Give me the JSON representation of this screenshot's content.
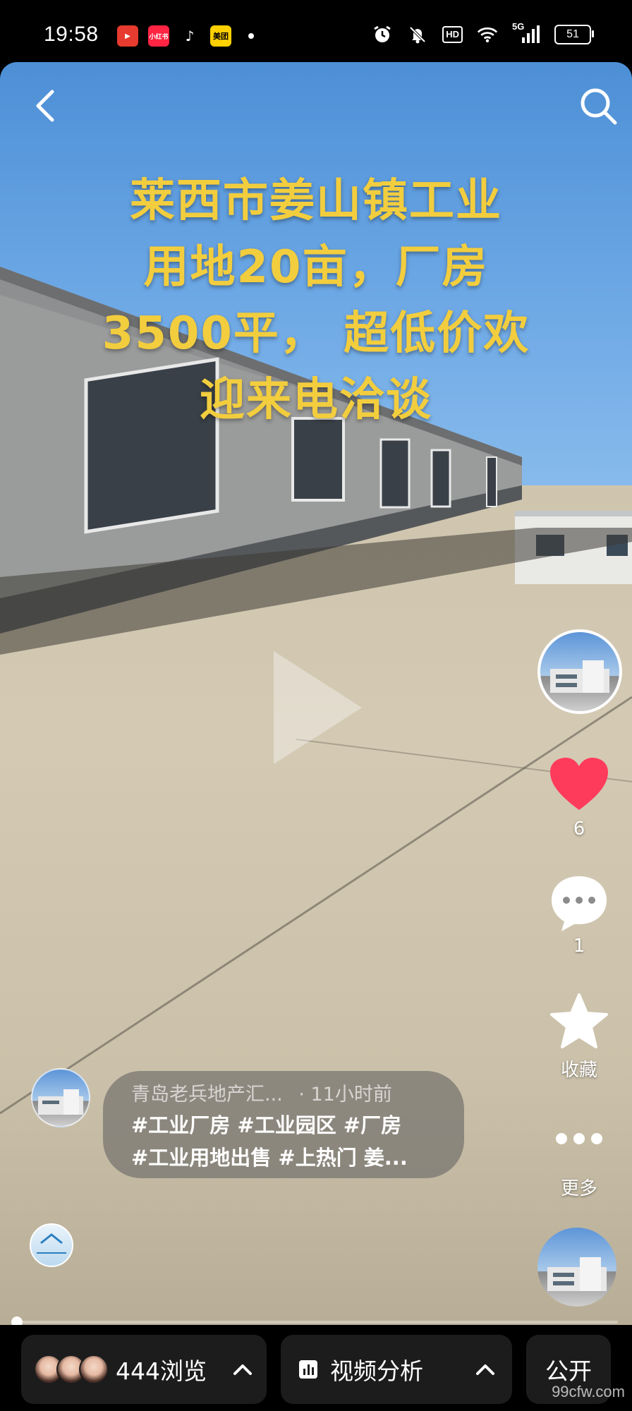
{
  "status_bar": {
    "time": "19:58",
    "app_icons": [
      "video-app-icon",
      "xiaohongshu-icon",
      "tiktok-icon",
      "meituan-icon"
    ],
    "app_icon_labels": [
      "▶",
      "小红书",
      "♪",
      "美团"
    ],
    "hd_label": "HD",
    "network_label": "5G",
    "battery": "51"
  },
  "video": {
    "title_lines": [
      "莱西市姜山镇工业",
      "用地20亩，厂房",
      "3500平， 超低价欢",
      "迎来电洽谈"
    ]
  },
  "rail": {
    "likes": "6",
    "comments": "1",
    "favorite_label": "收藏",
    "more_label": "更多"
  },
  "post": {
    "author": "青岛老兵地产汇...",
    "time_ago": "· 11小时前",
    "tags_line1": "#工业厂房 #工业园区 #厂房",
    "tags_line2": "#工业用地出售 #上热门 姜..."
  },
  "progress": {
    "fraction": 0.005
  },
  "bottom_bar": {
    "views_label": "444浏览",
    "analysis_label": "视频分析",
    "public_label": "公开"
  },
  "watermark": "99cfw.com",
  "colors": {
    "title_yellow": "#f2cd3e",
    "like_red": "#ff3b5c"
  }
}
